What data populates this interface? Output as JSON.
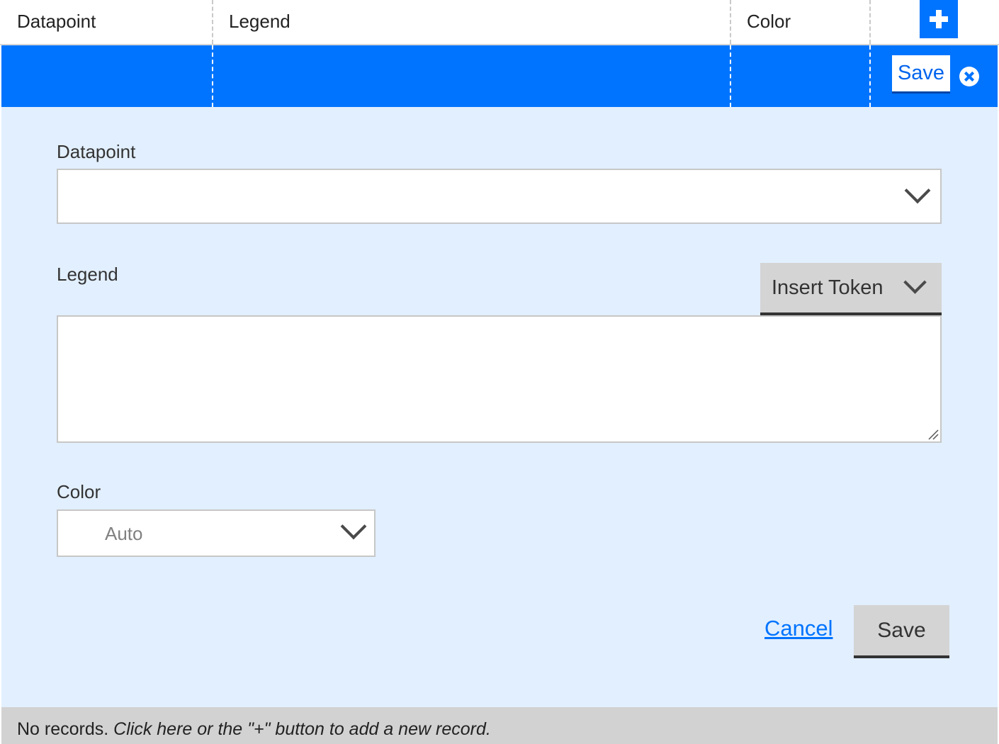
{
  "table": {
    "columns": {
      "datapoint": "Datapoint",
      "legend": "Legend",
      "color": "Color"
    },
    "add_button_icon": "plus-icon",
    "row_save_label": "Save",
    "row_close_icon": "close-circle-icon"
  },
  "form": {
    "datapoint": {
      "label": "Datapoint",
      "value": ""
    },
    "legend": {
      "label": "Legend",
      "insert_token_label": "Insert Token",
      "value": ""
    },
    "color": {
      "label": "Color",
      "value": "Auto"
    },
    "cancel_label": "Cancel",
    "save_label": "Save"
  },
  "footer": {
    "text_plain": "No records.",
    "text_italic": "Click here or the \"+\" button to add a new record."
  },
  "colors": {
    "accent": "#0074ff",
    "panel_background": "#e2efff",
    "footer_background": "#d2d2d2",
    "button_gray": "#d4d4d4"
  }
}
